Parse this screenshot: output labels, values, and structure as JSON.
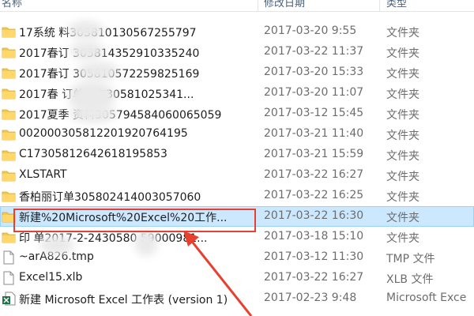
{
  "columns": {
    "name": "名称",
    "date": "修改日期",
    "type": "类型"
  },
  "rows": [
    {
      "icon": "folder-icon",
      "name": "17系统        料305810130567255797",
      "date": "2017-03-20 9:55",
      "type": "文件夹"
    },
    {
      "icon": "folder-icon",
      "name": "2017春订      305814352910335240",
      "date": "2017-03-22 11:37",
      "type": "文件夹"
    },
    {
      "icon": "folder-icon",
      "name": "2017春订       305810572259825169",
      "date": "2017-03-20 15:33",
      "type": "文件夹"
    },
    {
      "icon": "folder-icon",
      "name": "2017春       订单状态30581025341...",
      "date": "2017-03-20 11:07",
      "type": "文件夹"
    },
    {
      "icon": "folder-icon",
      "name": "2017夏季      资料305794584060065059",
      "date": "2017-03-12 15:45",
      "type": "文件夹"
    },
    {
      "icon": "folder-icon",
      "name": "002000305812201920764195",
      "date": "2017-03-21 11:40",
      "type": "文件夹"
    },
    {
      "icon": "folder-icon",
      "name": "C17305812642618195853",
      "date": "2017-03-21 15:59",
      "type": "文件夹"
    },
    {
      "icon": "folder-icon",
      "name": "XLSTART",
      "date": "2017-03-22 16:27",
      "type": "文件夹"
    },
    {
      "icon": "folder-icon",
      "name": "香柏丽订单305802414003057060",
      "date": "2017-03-22 16:25",
      "type": "文件夹"
    },
    {
      "icon": "folder-icon",
      "name": "新建%20Microsoft%20Excel%20工作...",
      "date": "2017-03-22 16:30",
      "type": "文件夹",
      "selected": true
    },
    {
      "icon": "folder-icon",
      "name": "印         单2017-2-2430580    59000981...",
      "date": "2017-03-18 15:10",
      "type": "文件夹"
    },
    {
      "icon": "file-icon",
      "name": "~arA826.tmp",
      "date": "2017-03-12 11:30",
      "type": "TMP 文件"
    },
    {
      "icon": "file-icon",
      "name": "Excel15.xlb",
      "date": "2017-03-22 16:27",
      "type": "XLB 文件"
    },
    {
      "icon": "excel-file-icon",
      "name": "新建 Microsoft Excel 工作表 (version 1)",
      "date": "2017-02-23 9:48",
      "type": "Microsoft Exce"
    }
  ],
  "colors": {
    "selection": "#cce8ff",
    "annotation": "#e8402f",
    "folder": "#f4c94e"
  }
}
